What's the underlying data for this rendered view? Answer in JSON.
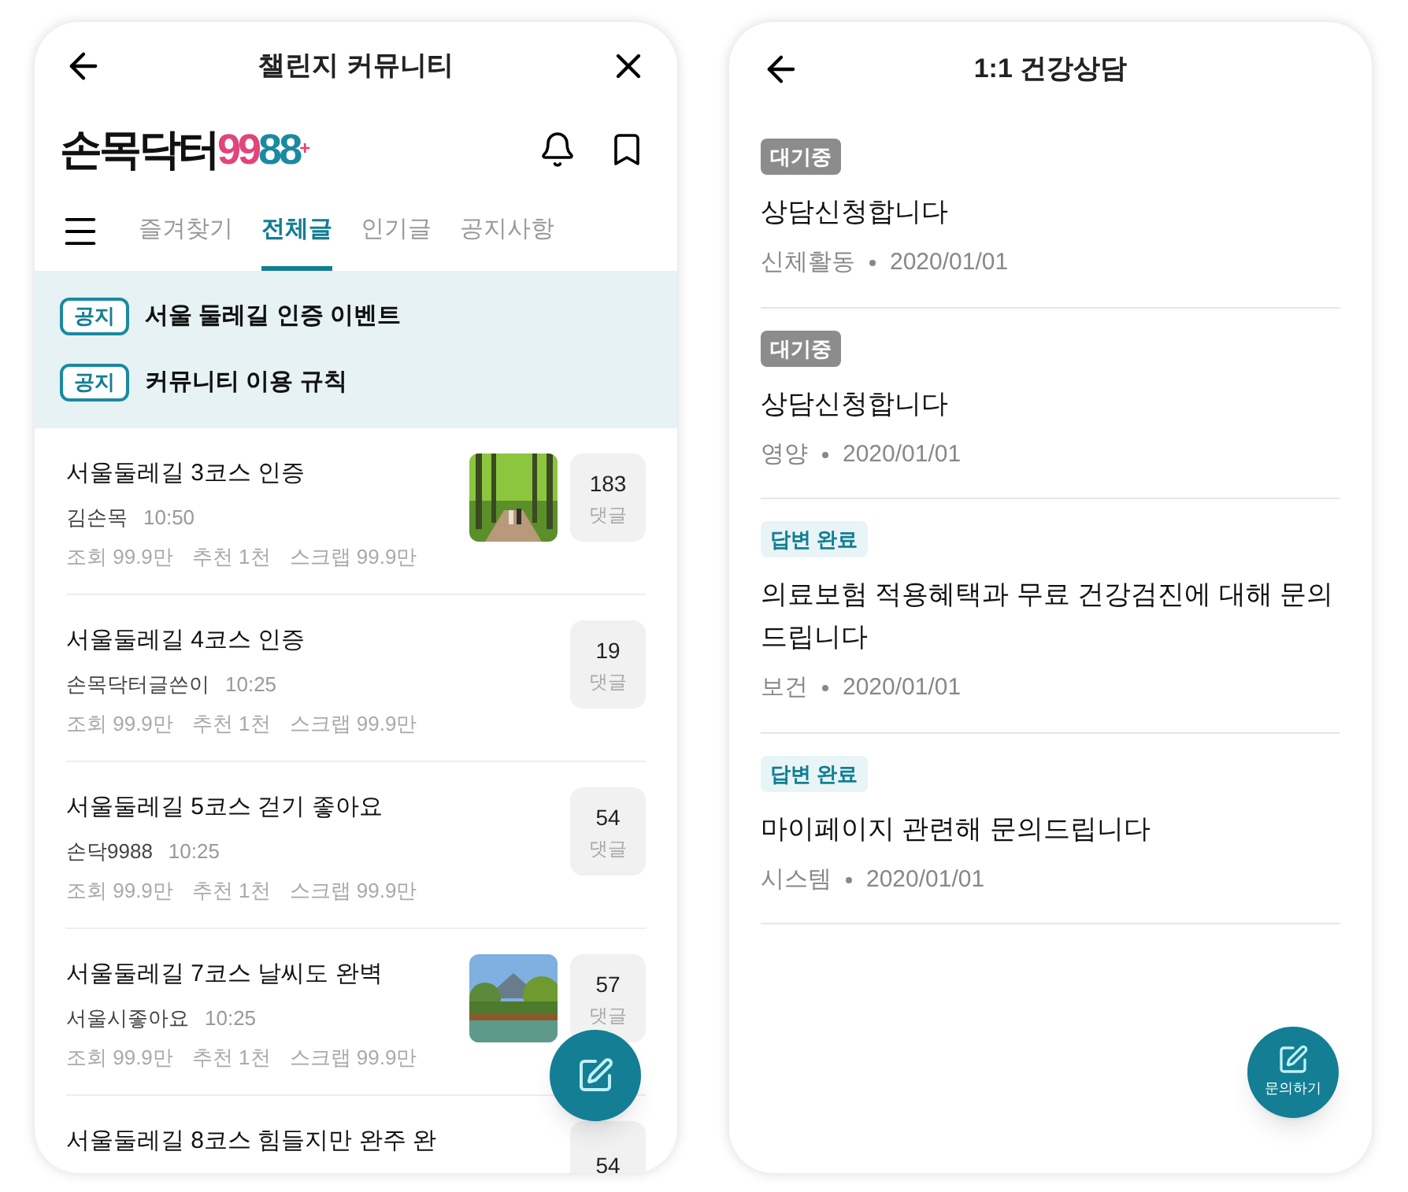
{
  "community": {
    "title": "챌린지 커뮤니티",
    "logo": {
      "text": "손목닥터",
      "accent_1": "99",
      "accent_2": "88",
      "mark": "+"
    },
    "tabs": [
      {
        "label": "즐겨찾기",
        "selected": false
      },
      {
        "label": "전체글",
        "selected": true
      },
      {
        "label": "인기글",
        "selected": false
      },
      {
        "label": "공지사항",
        "selected": false
      }
    ],
    "notices": [
      {
        "badge": "공지",
        "text": "서울 둘레길 인증 이벤트"
      },
      {
        "badge": "공지",
        "text": "커뮤니티 이용 규칙"
      }
    ],
    "posts": [
      {
        "title": "서울둘레길 3코스 인증",
        "author": "김손목",
        "time": "10:50",
        "stats": [
          "조회 99.9만",
          "추천 1천",
          "스크랩 99.9만"
        ],
        "comments": "183",
        "comment_label": "댓글",
        "thumbnail": {
          "kind": "picture"
        }
      },
      {
        "title": "서울둘레길 4코스 인증",
        "author": "손목닥터글쓴이",
        "time": "10:25",
        "stats": [
          "조회 99.9만",
          "추천 1천",
          "스크랩 99.9만"
        ],
        "comments": "19",
        "comment_label": "댓글"
      },
      {
        "title": "서울둘레길 5코스 걷기 좋아요",
        "author": "손닥9988",
        "time": "10:25",
        "stats": [
          "조회 99.9만",
          "추천 1천",
          "스크랩 99.9만"
        ],
        "comments": "54",
        "comment_label": "댓글"
      },
      {
        "title": "서울둘레길 7코스 날씨도 완벽",
        "author": "서울시좋아요",
        "time": "10:25",
        "stats": [
          "조회 99.9만",
          "추천 1천",
          "스크랩 99.9만"
        ],
        "comments": "57",
        "comment_label": "댓글",
        "thumbnail": {
          "kind": "picture"
        }
      },
      {
        "title": "서울둘레길 8코스 힘들지만 완주 완",
        "comments": "54"
      }
    ]
  },
  "consult": {
    "title": "1:1 건강상담",
    "items": [
      {
        "status": "대기중",
        "kind": "waiting",
        "title": "상담신청합니다",
        "category": "신체활동",
        "date": "2020/01/01"
      },
      {
        "status": "대기중",
        "kind": "waiting",
        "title": "상담신청합니다",
        "category": "영양",
        "date": "2020/01/01"
      },
      {
        "status": "답변 완료",
        "kind": "done",
        "title": "의료보험 적용혜택과 무료 건강검진에 대해 문의드립니다",
        "category": "보건",
        "date": "2020/01/01"
      },
      {
        "status": "답변 완료",
        "kind": "done",
        "title": "마이페이지 관련해 문의드립니다",
        "category": "시스템",
        "date": "2020/01/01"
      }
    ],
    "fab_label": "문의하기"
  }
}
